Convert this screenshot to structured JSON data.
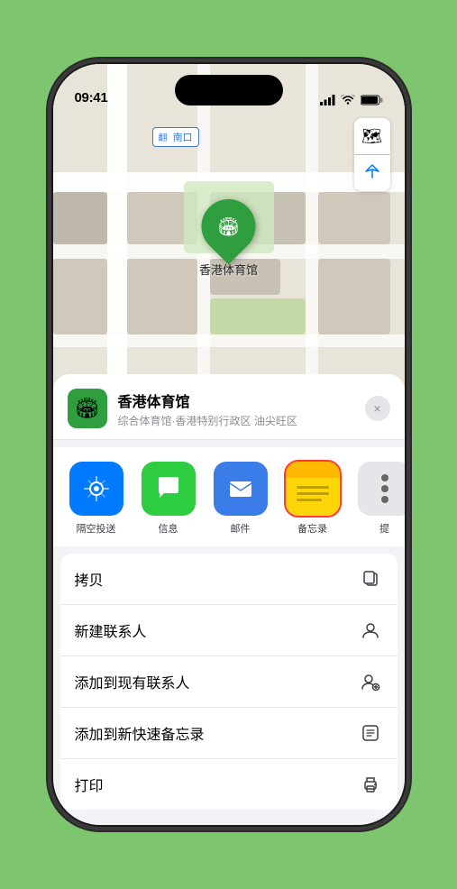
{
  "status_bar": {
    "time": "09:41",
    "signal_label": "signal",
    "wifi_label": "wifi",
    "battery_label": "battery"
  },
  "map": {
    "label": "南口",
    "pin_name": "香港体育馆",
    "pin_label": "香港体育馆"
  },
  "map_controls": {
    "layers_icon": "🗺",
    "location_icon": "➤"
  },
  "sheet": {
    "venue_name": "香港体育馆",
    "venue_sub": "综合体育馆·香港特别行政区 油尖旺区",
    "close_label": "×"
  },
  "share_items": [
    {
      "id": "airdrop",
      "label": "隔空投送",
      "type": "airdrop"
    },
    {
      "id": "message",
      "label": "信息",
      "type": "message"
    },
    {
      "id": "mail",
      "label": "邮件",
      "type": "mail"
    },
    {
      "id": "notes",
      "label": "备忘录",
      "type": "notes",
      "highlighted": true
    },
    {
      "id": "more",
      "label": "提",
      "type": "more"
    }
  ],
  "actions": [
    {
      "label": "拷贝",
      "icon": "copy"
    },
    {
      "label": "新建联系人",
      "icon": "person"
    },
    {
      "label": "添加到现有联系人",
      "icon": "person-add"
    },
    {
      "label": "添加到新快速备忘录",
      "icon": "note"
    },
    {
      "label": "打印",
      "icon": "print"
    }
  ]
}
